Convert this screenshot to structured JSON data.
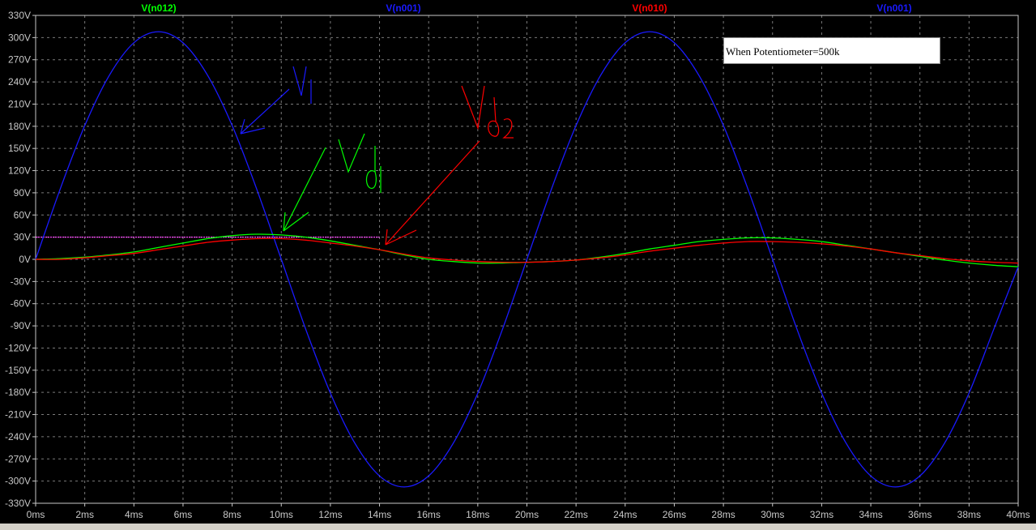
{
  "chart_data": {
    "type": "line",
    "title": "",
    "xlabel": "",
    "ylabel": "",
    "xlim": [
      0,
      40
    ],
    "ylim": [
      -330,
      330
    ],
    "grid": true,
    "x_ticks": [
      "0ms",
      "2ms",
      "4ms",
      "6ms",
      "8ms",
      "10ms",
      "12ms",
      "14ms",
      "16ms",
      "18ms",
      "20ms",
      "22ms",
      "24ms",
      "26ms",
      "28ms",
      "30ms",
      "32ms",
      "34ms",
      "36ms",
      "38ms",
      "40ms"
    ],
    "y_ticks": [
      "330V",
      "300V",
      "270V",
      "240V",
      "210V",
      "180V",
      "150V",
      "120V",
      "90V",
      "60V",
      "30V",
      "0V",
      "-30V",
      "-60V",
      "-90V",
      "-120V",
      "-150V",
      "-180V",
      "-210V",
      "-240V",
      "-270V",
      "-300V",
      "-330V"
    ],
    "legend": [
      "V(n012)",
      "V(n001)",
      "V(n010)",
      "V(n001)"
    ],
    "series": [
      {
        "name": "V(n001)",
        "color": "#1a1aff",
        "x": [
          0,
          1,
          2,
          3,
          4,
          5,
          6,
          7,
          8,
          9,
          10,
          11,
          12,
          13,
          14,
          15,
          16,
          17,
          18,
          19,
          20,
          21,
          22,
          23,
          24,
          25,
          26,
          27,
          28,
          29,
          30,
          31,
          32,
          33,
          34,
          35,
          36,
          37,
          38,
          39,
          40
        ],
        "values": [
          0,
          95,
          181,
          249,
          293,
          308,
          293,
          249,
          181,
          95,
          0,
          -95,
          -181,
          -249,
          -293,
          -308,
          -293,
          -249,
          -181,
          -95,
          0,
          95,
          181,
          249,
          293,
          308,
          293,
          249,
          181,
          95,
          0,
          -95,
          -181,
          -249,
          -293,
          -308,
          -293,
          -249,
          -181,
          -95,
          -10
        ]
      },
      {
        "name": "V(n012)",
        "color": "#00ff00",
        "x": [
          0,
          1,
          2,
          3,
          4,
          5,
          6,
          7,
          8,
          9,
          10,
          11,
          12,
          13,
          14,
          15,
          16,
          17,
          18,
          19,
          20,
          21,
          22,
          23,
          24,
          25,
          26,
          27,
          28,
          29,
          30,
          31,
          32,
          33,
          34,
          35,
          36,
          37,
          38,
          39,
          40
        ],
        "values": [
          0,
          1,
          3,
          6,
          10,
          16,
          22,
          28,
          32,
          34,
          33,
          30,
          25,
          19,
          13,
          6,
          0,
          -3,
          -5,
          -5,
          -4,
          -3,
          -1,
          3,
          8,
          14,
          19,
          24,
          27,
          29,
          29,
          27,
          24,
          19,
          14,
          9,
          4,
          -1,
          -5,
          -8,
          -10
        ]
      },
      {
        "name": "V(n010)",
        "color": "#ff0000",
        "x": [
          0,
          1,
          2,
          3,
          4,
          5,
          6,
          7,
          8,
          9,
          10,
          11,
          12,
          13,
          14,
          15,
          16,
          17,
          18,
          19,
          20,
          21,
          22,
          23,
          24,
          25,
          26,
          27,
          28,
          29,
          30,
          31,
          32,
          33,
          34,
          35,
          36,
          37,
          38,
          39,
          40
        ],
        "values": [
          0,
          0,
          2,
          5,
          8,
          13,
          18,
          23,
          26,
          28,
          28,
          26,
          22,
          18,
          13,
          7,
          2,
          -1,
          -3,
          -4,
          -4,
          -3,
          -1,
          2,
          6,
          11,
          15,
          19,
          22,
          24,
          24,
          23,
          21,
          18,
          14,
          9,
          5,
          1,
          -2,
          -4,
          -5
        ]
      }
    ],
    "reference_line": {
      "color": "#ff44ff",
      "y": 30,
      "x_start": 0,
      "x_end": 14
    },
    "annotations": [
      {
        "label": "V",
        "subscript": "i",
        "color": "#1a1aff"
      },
      {
        "label": "V",
        "subscript": "d1",
        "color": "#00ff00"
      },
      {
        "label": "V",
        "subscript": "d2",
        "color": "#ff0000"
      }
    ],
    "note": "When Potentiometer=500k"
  }
}
